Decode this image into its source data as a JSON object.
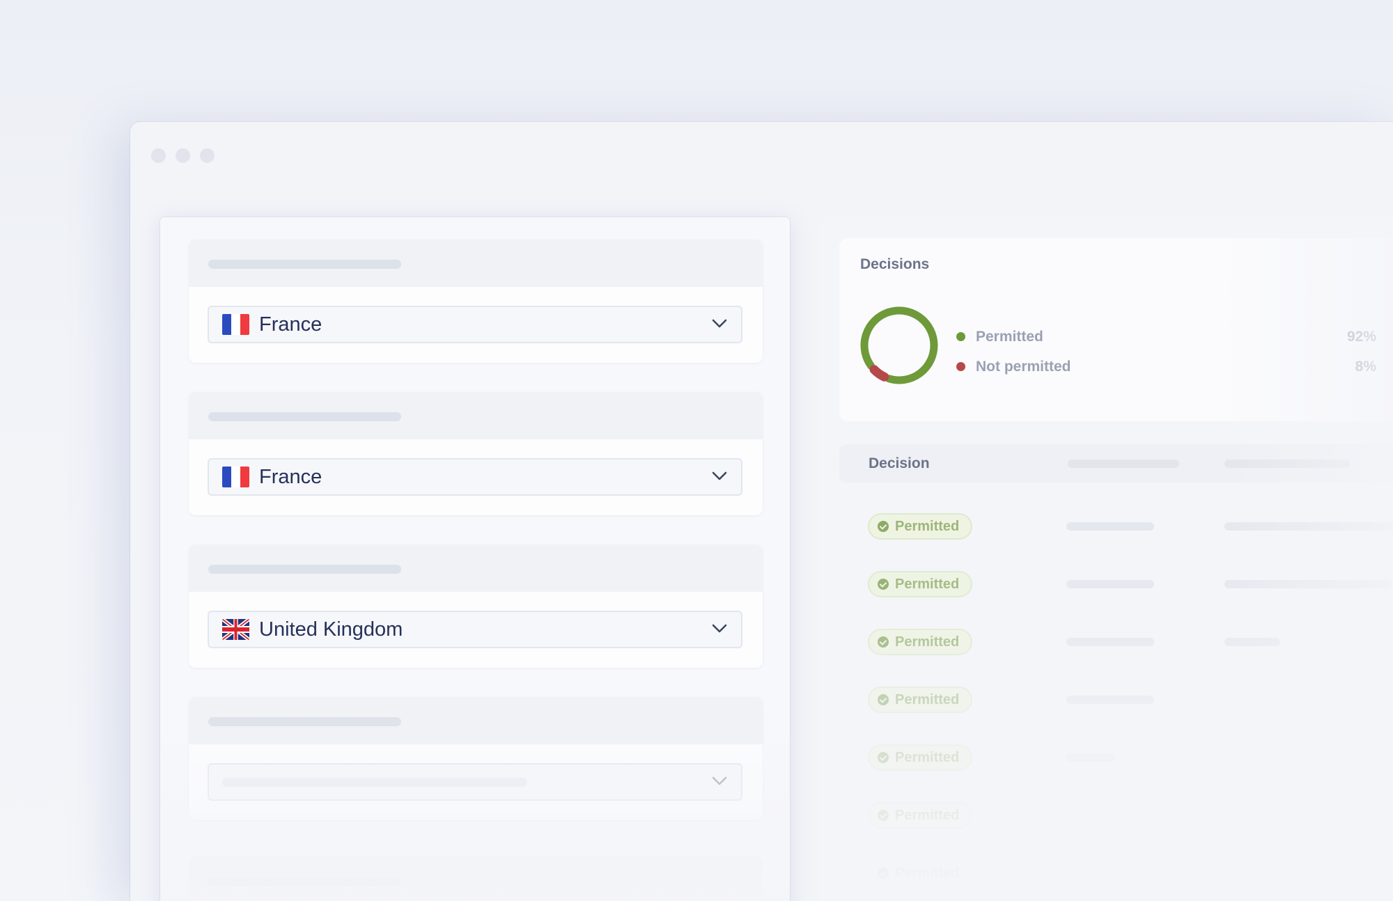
{
  "form": {
    "fields": [
      {
        "value": "France",
        "flag": "france"
      },
      {
        "value": "France",
        "flag": "france"
      },
      {
        "value": "United Kingdom",
        "flag": "united-kingdom"
      },
      {
        "value": "",
        "flag": ""
      }
    ]
  },
  "decisions": {
    "title": "Decisions",
    "colors": {
      "permitted": "#6e9a3a",
      "not_permitted": "#b5494a"
    },
    "legend": [
      {
        "label": "Permitted",
        "value": "92%"
      },
      {
        "label": "Not permitted",
        "value": "8%"
      }
    ]
  },
  "chart_data": {
    "type": "pie",
    "title": "Decisions",
    "categories": [
      "Permitted",
      "Not permitted"
    ],
    "values": [
      92,
      8
    ]
  },
  "table": {
    "header": "Decision",
    "rows": [
      {
        "decision": "Permitted"
      },
      {
        "decision": "Permitted"
      },
      {
        "decision": "Permitted"
      },
      {
        "decision": "Permitted"
      },
      {
        "decision": "Permitted"
      },
      {
        "decision": "Permitted"
      },
      {
        "decision": "Permitted"
      }
    ]
  }
}
